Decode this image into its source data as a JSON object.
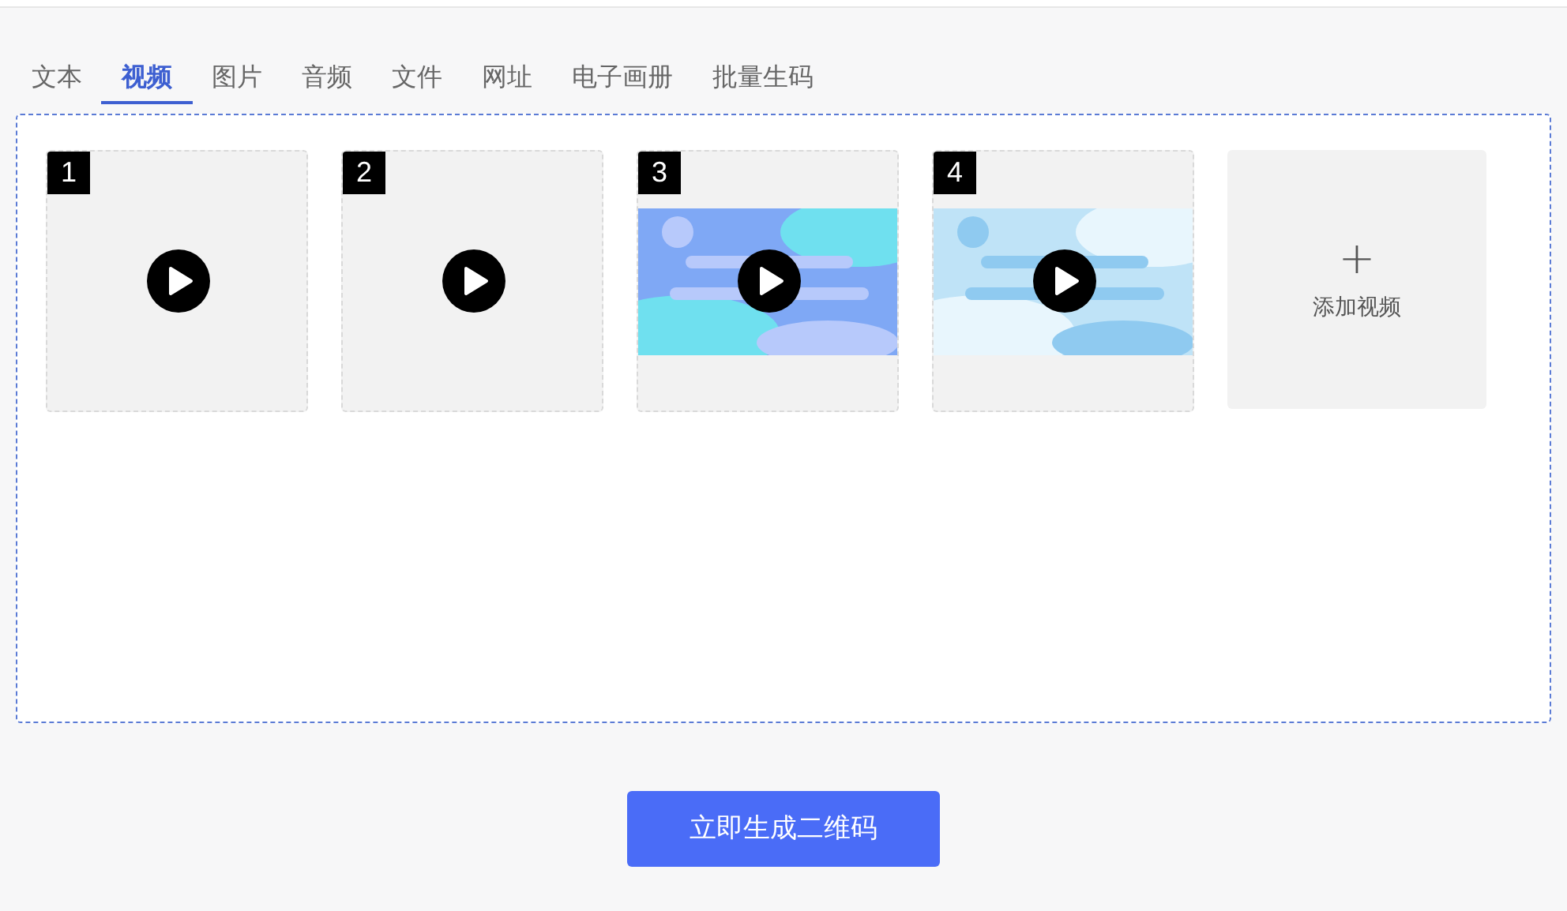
{
  "tabs": [
    {
      "label": "文本",
      "selected": false
    },
    {
      "label": "视频",
      "selected": true
    },
    {
      "label": "图片",
      "selected": false
    },
    {
      "label": "音频",
      "selected": false
    },
    {
      "label": "文件",
      "selected": false
    },
    {
      "label": "网址",
      "selected": false
    },
    {
      "label": "电子画册",
      "selected": false
    },
    {
      "label": "批量生码",
      "selected": false
    }
  ],
  "videos": [
    {
      "number": "1",
      "kind": "blank"
    },
    {
      "number": "2",
      "kind": "blank"
    },
    {
      "number": "3",
      "kind": "picture"
    },
    {
      "number": "4",
      "kind": "picture"
    }
  ],
  "add_video": {
    "icon": "+",
    "label": "添加视频"
  },
  "generate_button": "立即生成二维码"
}
